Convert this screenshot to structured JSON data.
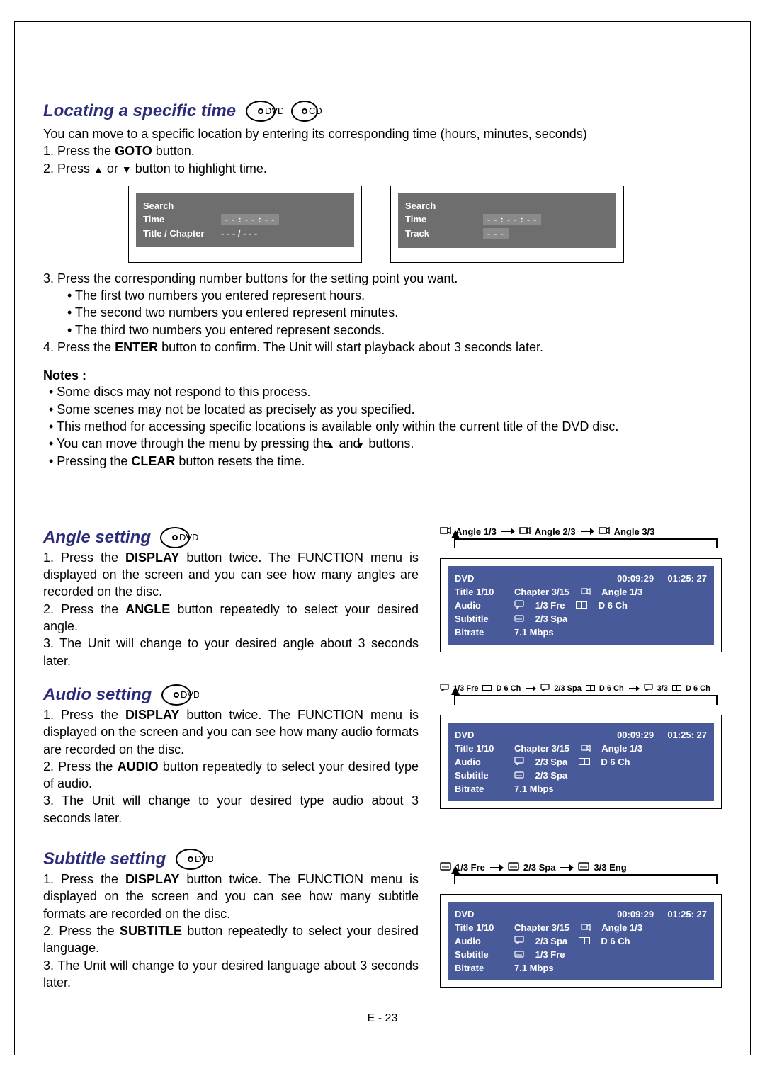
{
  "page_number": "E - 23",
  "disc_labels": {
    "dvd": "DVD",
    "cd": "CD"
  },
  "locating": {
    "title": "Locating a specific time",
    "intro": "You can move to a specific location by entering its corresponding time (hours, minutes, seconds)",
    "step1_pre": "1. Press the ",
    "step1_bold": "GOTO",
    "step1_post": " button.",
    "step2_pre": "2. Press ",
    "step2_mid": " or ",
    "step2_post": " button to highlight time.",
    "panel_dvd": {
      "search": "Search",
      "time_label": "Time",
      "time_value": "- - : - - : - -",
      "tc_label": "Title / Chapter",
      "tc_value": "- - - / - - -"
    },
    "panel_cd": {
      "search": "Search",
      "time_label": "Time",
      "time_value": "- - : - - : - -",
      "track_label": "Track",
      "track_value": "- - -"
    },
    "step3": "3. Press the corresponding number buttons for the setting point you want.",
    "step3a": "• The first two numbers you entered represent hours.",
    "step3b": "• The second two numbers you entered represent minutes.",
    "step3c": "• The third two numbers you entered represent seconds.",
    "step4_pre": "4. Press the ",
    "step4_bold": "ENTER",
    "step4_post": " button to confirm. The Unit will start playback about 3 seconds later.",
    "notes_h": "Notes :",
    "note1": "•  Some discs may not respond to this process.",
    "note2": "•  Some scenes may not be located as precisely as you specified.",
    "note3": "•  This method for accessing specific locations is available only within the current title of the DVD disc.",
    "note4_pre": "•  You can move through the menu by pressing the ",
    "note4_mid": " and ",
    "note4_post": " buttons.",
    "note5_pre": "•  Pressing the ",
    "note5_bold": "CLEAR",
    "note5_post": " button resets the time."
  },
  "angle": {
    "title": "Angle setting",
    "step1_pre": "1. Press the ",
    "step1_bold": "DISPLAY",
    "step1_post": " button twice. The FUNCTION menu is displayed on the screen and you can see how many angles are recorded on the disc.",
    "step2_pre": "2. Press the ",
    "step2_bold": "ANGLE",
    "step2_post": " button repeatedly to select your desired angle.",
    "step3": "3. The Unit will change to your desired angle about 3 seconds later.",
    "cycle": {
      "a": "Angle 1/3",
      "b": "Angle 2/3",
      "c": "Angle 3/3"
    },
    "osd": {
      "dvd": "DVD",
      "t_elapsed": "00:09:29",
      "t_total": "01:25: 27",
      "title": "Title  1/10",
      "chapter": "Chapter  3/15",
      "angle": "Angle 1/3",
      "audio_l": "Audio",
      "audio_v": "1/3 Fre",
      "audio_dd": "D 6 Ch",
      "sub_l": "Subtitle",
      "sub_v": "2/3 Spa",
      "bit_l": "Bitrate",
      "bit_v": "7.1 Mbps"
    }
  },
  "audio": {
    "title": "Audio setting",
    "step1_pre": "1. Press the ",
    "step1_bold": "DISPLAY",
    "step1_post": " button twice. The FUNCTION menu is displayed on the screen and you can see how many audio formats are recorded on the disc.",
    "step2_pre": "2. Press the ",
    "step2_bold": "AUDIO",
    "step2_post": " button repeatedly to select your desired type of audio.",
    "step3": "3. The Unit will change to your desired type audio about 3 seconds later.",
    "cycle": {
      "a": "1/3 Fre",
      "b": "2/3 Spa",
      "c": "3/3",
      "dd": "D 6 Ch"
    },
    "osd": {
      "dvd": "DVD",
      "t_elapsed": "00:09:29",
      "t_total": "01:25: 27",
      "title": "Title  1/10",
      "chapter": "Chapter  3/15",
      "angle": "Angle 1/3",
      "audio_l": "Audio",
      "audio_v": "2/3 Spa",
      "audio_dd": "D 6 Ch",
      "sub_l": "Subtitle",
      "sub_v": "2/3 Spa",
      "bit_l": "Bitrate",
      "bit_v": "7.1 Mbps"
    }
  },
  "subtitle": {
    "title": "Subtitle setting",
    "step1_pre": "1. Press the ",
    "step1_bold": "DISPLAY",
    "step1_post": " button twice. The FUNCTION menu is displayed on the screen and you can see how many subtitle formats are recorded on the disc.",
    "step2_pre": "2. Press the ",
    "step2_bold": "SUBTITLE",
    "step2_post": " button repeatedly to select your desired language.",
    "step3": "3. The Unit will change to your desired language about 3 seconds later.",
    "cycle": {
      "a": "1/3 Fre",
      "b": "2/3 Spa",
      "c": "3/3 Eng"
    },
    "osd": {
      "dvd": "DVD",
      "t_elapsed": "00:09:29",
      "t_total": "01:25: 27",
      "title": "Title  1/10",
      "chapter": "Chapter  3/15",
      "angle": "Angle 1/3",
      "audio_l": "Audio",
      "audio_v": "2/3 Spa",
      "audio_dd": "D 6 Ch",
      "sub_l": "Subtitle",
      "sub_v": "1/3 Fre",
      "bit_l": "Bitrate",
      "bit_v": "7.1 Mbps"
    }
  }
}
